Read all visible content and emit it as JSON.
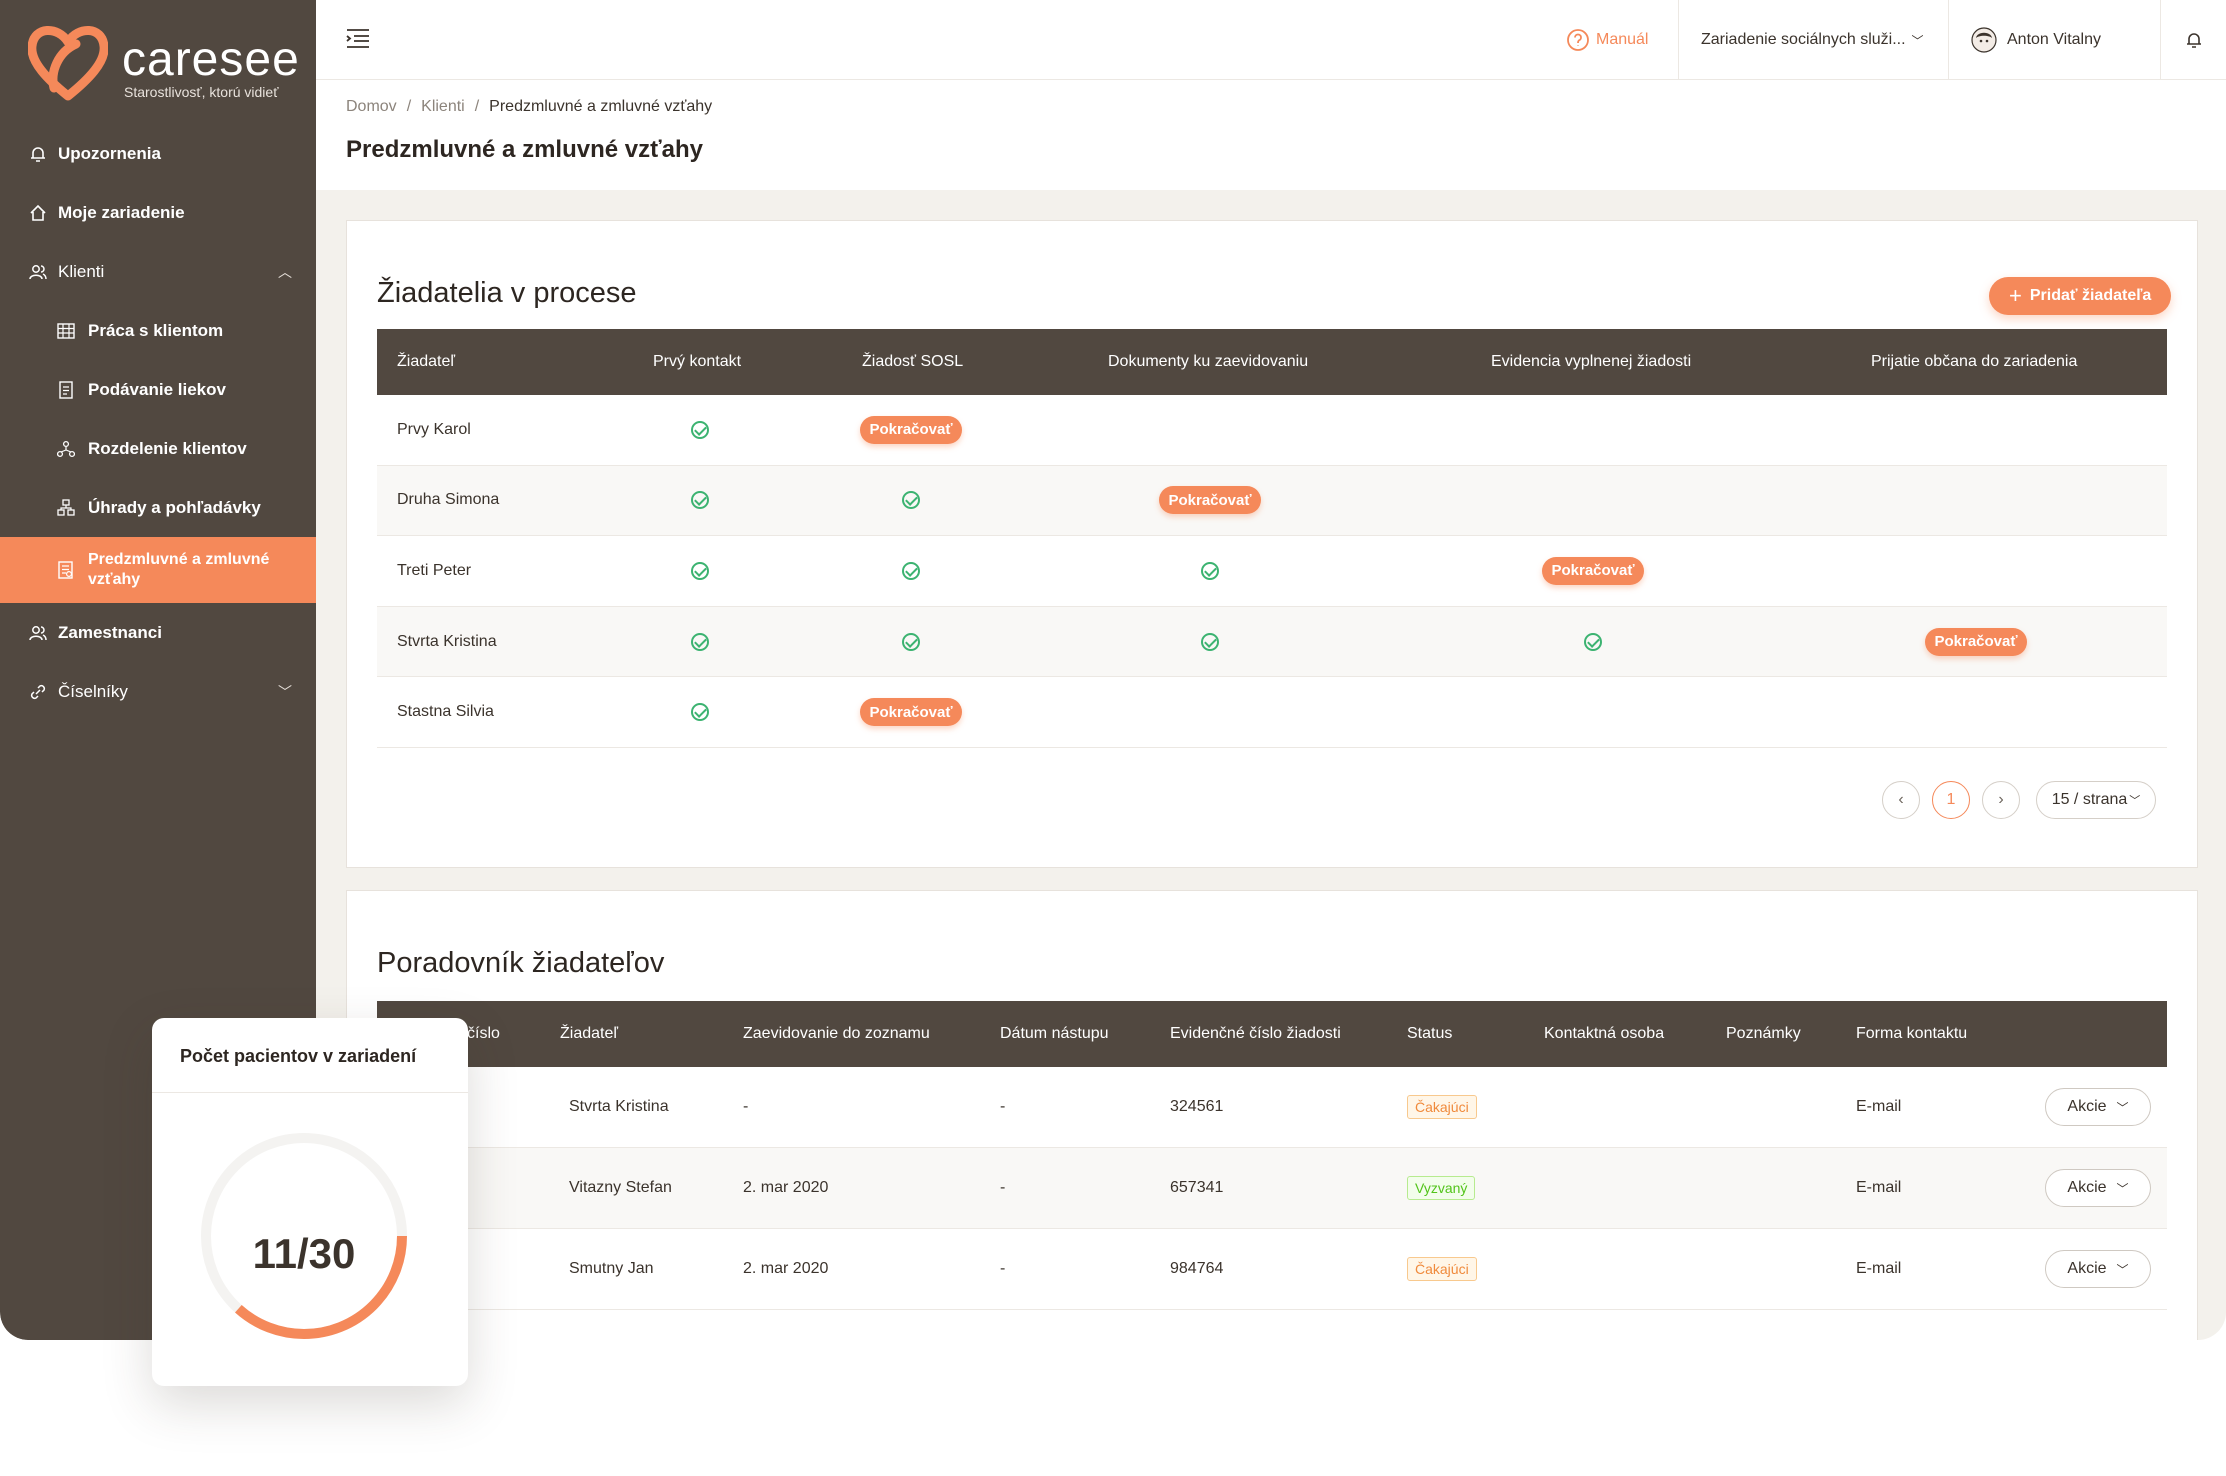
{
  "brand": {
    "name": "caresee",
    "tagline": "Starostlivosť, ktorú vidieť",
    "accent": "#f5895a",
    "sidebar_bg": "#514840"
  },
  "sidebar": {
    "items": [
      {
        "label": "Upozornenia",
        "icon": "bell-icon"
      },
      {
        "label": "Moje zariadenie",
        "icon": "home-icon"
      },
      {
        "label": "Klienti",
        "icon": "users-icon"
      },
      {
        "label": "Práca s klientom",
        "icon": "table-icon"
      },
      {
        "label": "Podávanie liekov",
        "icon": "document-icon"
      },
      {
        "label": "Rozdelenie klientov",
        "icon": "hierarchy-icon"
      },
      {
        "label": "Úhrady a pohľadávky",
        "icon": "payments-icon"
      },
      {
        "label": "Predzmluvné a zmluvné vzťahy",
        "icon": "contract-icon"
      },
      {
        "label": "Zamestnanci",
        "icon": "users-icon"
      },
      {
        "label": "Číselníky",
        "icon": "link-icon"
      }
    ]
  },
  "topbar": {
    "manual": "Manuál",
    "facility": "Zariadenie sociálnych služi...",
    "user": "Anton Vitalny"
  },
  "breadcrumb": {
    "home": "Domov",
    "clients": "Klienti",
    "current": "Predzmluvné a zmluvné vzťahy"
  },
  "page_title": "Predzmluvné a zmluvné vzťahy",
  "applicants": {
    "title": "Žiadatelia v procese",
    "add_button": "Pridať žiadateľa",
    "continue_label": "Pokračovať",
    "columns": [
      "Žiadateľ",
      "Prvý kontakt",
      "Žiadosť SOSL",
      "Dokumenty ku zaevidovaniu",
      "Evidencia vyplnenej žiadosti",
      "Prijatie občana do zariadenia"
    ],
    "rows": [
      {
        "name": "Prvy Karol",
        "steps": [
          "done",
          "continue",
          "",
          "",
          ""
        ]
      },
      {
        "name": "Druha Simona",
        "steps": [
          "done",
          "done",
          "continue",
          "",
          ""
        ]
      },
      {
        "name": "Treti Peter",
        "steps": [
          "done",
          "done",
          "done",
          "continue",
          ""
        ]
      },
      {
        "name": "Stvrta Kristina",
        "steps": [
          "done",
          "done",
          "done",
          "done",
          "continue"
        ]
      },
      {
        "name": "Stastna Silvia",
        "steps": [
          "done",
          "continue",
          "",
          "",
          ""
        ]
      }
    ],
    "pagination": {
      "current": "1",
      "page_size": "15 / strana"
    }
  },
  "waitlist": {
    "title": "Poradovník žiadateľov",
    "columns": [
      "číslo",
      "Žiadateľ",
      "Zaevidovanie do zoznamu",
      "Dátum nástupu",
      "Evidenčné číslo žiadosti",
      "Status",
      "Kontaktná osoba",
      "Poznámky",
      "Forma kontaktu"
    ],
    "actions_label": "Akcie",
    "rows": [
      {
        "name": "Stvrta Kristina",
        "registered": "-",
        "start": "-",
        "number": "324561",
        "status": "Čakajúci",
        "status_type": "wait",
        "contact_form": "E-mail"
      },
      {
        "name": "Vitazny Stefan",
        "registered": "2. mar 2020",
        "start": "-",
        "number": "657341",
        "status": "Vyzvaný",
        "status_type": "called",
        "contact_form": "E-mail"
      },
      {
        "name": "Smutny Jan",
        "registered": "2. mar 2020",
        "start": "-",
        "number": "984764",
        "status": "Čakajúci",
        "status_type": "wait",
        "contact_form": "E-mail"
      }
    ]
  },
  "widget": {
    "title": "Počet pacientov v zariadení",
    "value": "11/30",
    "current": 11,
    "capacity": 30
  }
}
